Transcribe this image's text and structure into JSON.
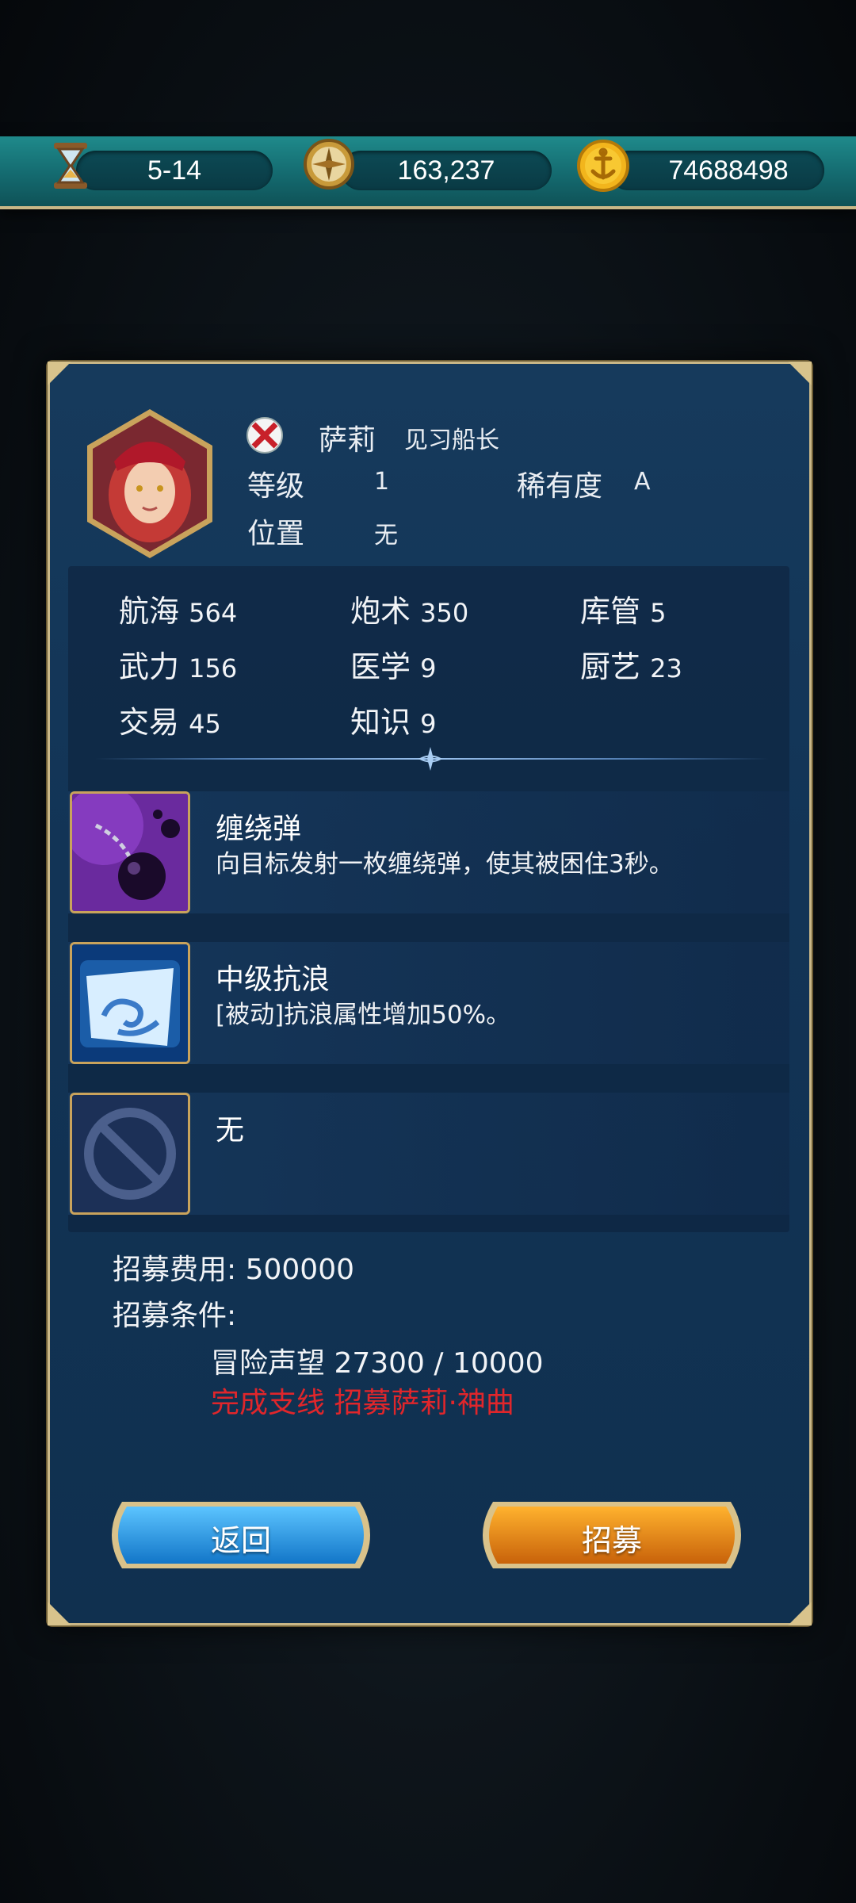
{
  "resources": {
    "stage": "5-14",
    "compass_value": "163,237",
    "gold": "74688498"
  },
  "officer": {
    "name": "萨莉",
    "title": "见习船长",
    "level_label": "等级",
    "level": "1",
    "rarity_label": "稀有度",
    "rarity": "A",
    "position_label": "位置",
    "position": "无"
  },
  "stats": [
    {
      "label": "航海",
      "value": "564"
    },
    {
      "label": "炮术",
      "value": "350"
    },
    {
      "label": "库管",
      "value": "5"
    },
    {
      "label": "武力",
      "value": "156"
    },
    {
      "label": "医学",
      "value": "9"
    },
    {
      "label": "厨艺",
      "value": "23"
    },
    {
      "label": "交易",
      "value": "45"
    },
    {
      "label": "知识",
      "value": "9"
    }
  ],
  "skills": [
    {
      "title": "缠绕弹",
      "desc": "向目标发射一枚缠绕弹，使其被困住3秒。",
      "icon": "chain-shot-icon"
    },
    {
      "title": "中级抗浪",
      "desc": "[被动]抗浪属性增加50%。",
      "icon": "wave-resist-icon"
    },
    {
      "title": "无",
      "desc": "",
      "icon": "empty-slot-icon"
    }
  ],
  "recruit": {
    "cost_label": "招募费用:",
    "cost": "500000",
    "condition_label": "招募条件:",
    "reputation": "冒险声望 27300 / 10000",
    "quest": "完成支线 招募萨莉·神曲"
  },
  "buttons": {
    "back": "返回",
    "recruit": "招募"
  },
  "colors": {
    "quest_red": "#e0262b",
    "back_blue": "#1f8fd8",
    "recruit_orange": "#e07a10"
  }
}
